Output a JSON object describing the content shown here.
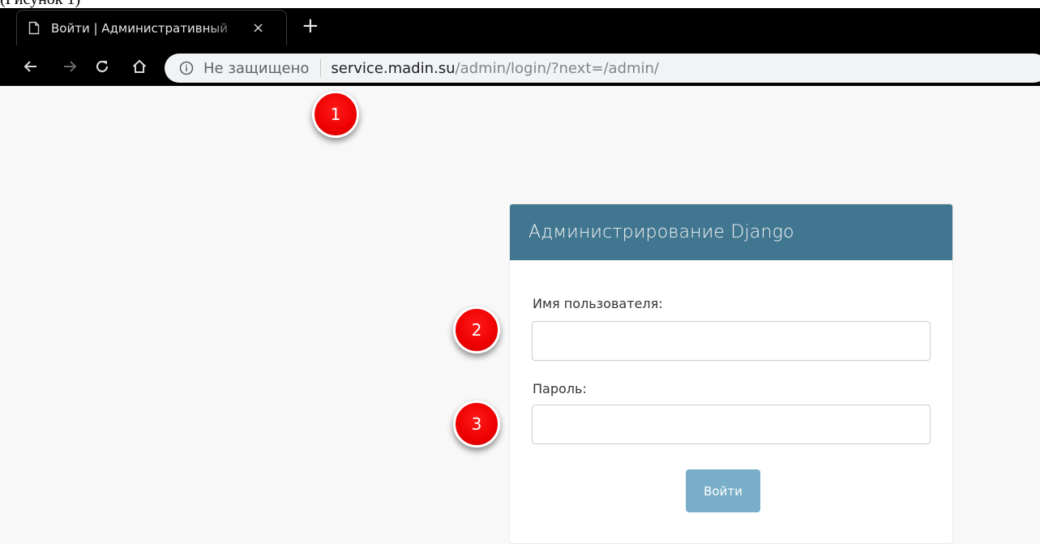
{
  "caption": "(Рисунок 1)",
  "browser": {
    "tab_title": "Войти | Административный",
    "tab_close": "×",
    "new_tab": "+",
    "omnibox": {
      "security_label": "Не защищено",
      "url_host": "service.madin.su",
      "url_path": "/admin/login/?next=/admin/"
    }
  },
  "login": {
    "header_title": "Администрирование Django",
    "username_label": "Имя пользователя:",
    "username_value": "",
    "password_label": "Пароль:",
    "password_value": "",
    "submit_label": "Войти"
  },
  "markers": [
    "1",
    "2",
    "3"
  ],
  "colors": {
    "header_bg": "#417690",
    "button_bg": "#79aec8",
    "marker_red": "#ee0000",
    "page_bg": "#f8f8f8"
  },
  "icons": [
    "page-icon",
    "back-arrow-icon",
    "forward-arrow-icon",
    "reload-icon",
    "home-icon",
    "info-icon"
  ]
}
